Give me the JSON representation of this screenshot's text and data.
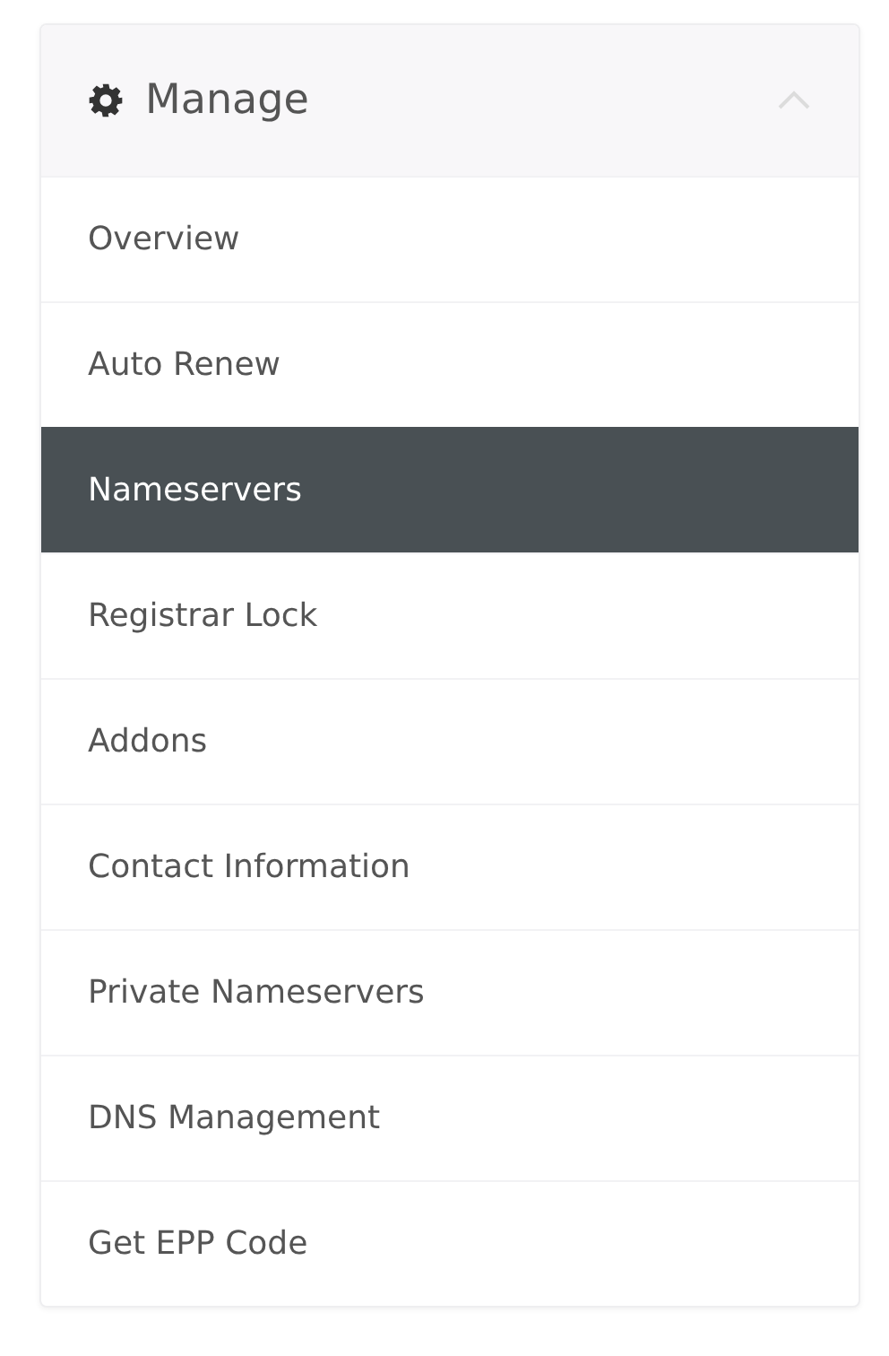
{
  "panel": {
    "title": "Manage",
    "expanded": true
  },
  "items": [
    {
      "label": "Overview",
      "selected": false
    },
    {
      "label": "Auto Renew",
      "selected": false
    },
    {
      "label": "Nameservers",
      "selected": true
    },
    {
      "label": "Registrar Lock",
      "selected": false
    },
    {
      "label": "Addons",
      "selected": false
    },
    {
      "label": "Contact Information",
      "selected": false
    },
    {
      "label": "Private Nameservers",
      "selected": false
    },
    {
      "label": "DNS Management",
      "selected": false
    },
    {
      "label": "Get EPP Code",
      "selected": false
    }
  ]
}
